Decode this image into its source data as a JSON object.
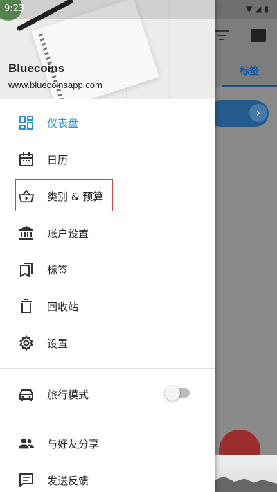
{
  "status": {
    "time": "9:23"
  },
  "brand": {
    "name": "Bluecoins",
    "url": "www.bluecoinsapp.com"
  },
  "background": {
    "tab_label": "标签"
  },
  "menu": {
    "items": [
      {
        "label": "仪表盘",
        "icon": "dashboard-icon",
        "active": true
      },
      {
        "label": "日历",
        "icon": "calendar-icon"
      },
      {
        "label": "类别 & 预算",
        "icon": "basket-icon"
      },
      {
        "label": "账户设置",
        "icon": "bank-icon"
      },
      {
        "label": "标签",
        "icon": "bookmark-icon"
      },
      {
        "label": "回收站",
        "icon": "trash-icon"
      },
      {
        "label": "设置",
        "icon": "gear-icon"
      }
    ],
    "travel_mode": {
      "label": "旅行模式",
      "icon": "car-icon",
      "enabled": false
    },
    "share": {
      "label": "与好友分享",
      "icon": "people-icon"
    },
    "feedback": {
      "label": "发送反馈",
      "icon": "feedback-icon"
    }
  },
  "colors": {
    "accent": "#2a92d6",
    "highlight_border": "#e53935"
  }
}
